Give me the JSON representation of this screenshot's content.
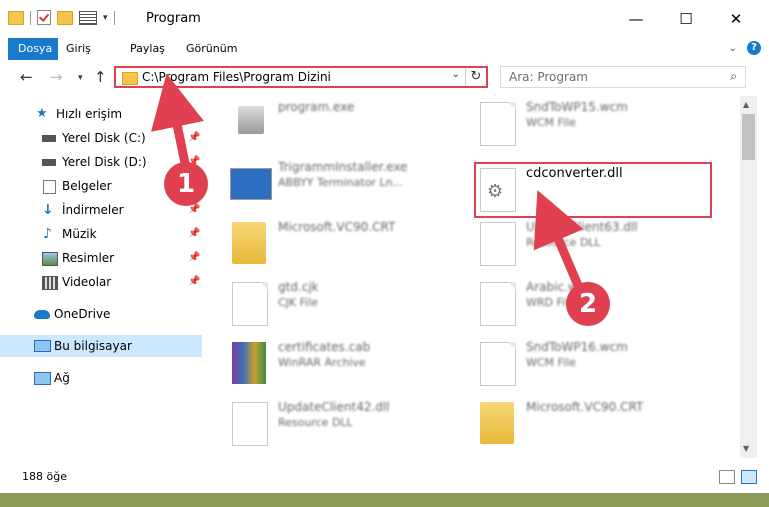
{
  "window": {
    "title": "Program"
  },
  "ribbon": {
    "tabs": [
      "Dosya",
      "Giriş",
      "Paylaş",
      "Görünüm"
    ]
  },
  "nav": {
    "address": "C:\\Program Files\\Program Dizini",
    "search_placeholder": "Ara: Program"
  },
  "sidebar": {
    "items": [
      {
        "label": "Hızlı erişim",
        "icon": "star-icon",
        "pinned": false
      },
      {
        "label": "Yerel Disk (C:)",
        "icon": "drive-icon",
        "pinned": true
      },
      {
        "label": "Yerel Disk (D:)",
        "icon": "drive-icon",
        "pinned": true
      },
      {
        "label": "Belgeler",
        "icon": "documents-icon",
        "pinned": true
      },
      {
        "label": "İndirmeler",
        "icon": "download-icon",
        "pinned": true
      },
      {
        "label": "Müzik",
        "icon": "music-icon",
        "pinned": true
      },
      {
        "label": "Resimler",
        "icon": "pictures-icon",
        "pinned": true
      },
      {
        "label": "Videolar",
        "icon": "videos-icon",
        "pinned": true
      },
      {
        "label": "OneDrive",
        "icon": "cloud-icon",
        "pinned": false
      },
      {
        "label": "Bu bilgisayar",
        "icon": "computer-icon",
        "pinned": false,
        "selected": true
      },
      {
        "label": "Ağ",
        "icon": "network-icon",
        "pinned": false
      }
    ]
  },
  "files": [
    {
      "name": "program.exe",
      "type": "",
      "icon": "exe-icon"
    },
    {
      "name": "SndToWP15.wcm",
      "type": "WCM File",
      "icon": "document-icon"
    },
    {
      "name": "TrigrammInstaller.exe",
      "type": "ABBYY Terminator Ln...",
      "icon": "installer-icon"
    },
    {
      "name": "cdconverter.dll",
      "type": "",
      "icon": "dll-gear-icon"
    },
    {
      "name": "Microsoft.VC90.CRT",
      "type": "",
      "icon": "folder-icon"
    },
    {
      "name": "UpdateClient63.dll",
      "type": "Resource DLL",
      "icon": "dll-gear-icon"
    },
    {
      "name": "gtd.cjk",
      "type": "CJK File",
      "icon": "document-icon"
    },
    {
      "name": "Arabic.wrd",
      "type": "WRD File",
      "icon": "document-icon"
    },
    {
      "name": "certificates.cab",
      "type": "WinRAR Archive",
      "icon": "archive-icon"
    },
    {
      "name": "SndToWP16.wcm",
      "type": "WCM File",
      "icon": "document-icon"
    },
    {
      "name": "UpdateClient42.dll",
      "type": "Resource DLL",
      "icon": "dll-gear-icon"
    },
    {
      "name": "Microsoft.VC90.CRT",
      "type": "",
      "icon": "folder-icon"
    }
  ],
  "status": {
    "count": "188 öğe"
  },
  "callouts": [
    "1",
    "2"
  ],
  "colors": {
    "accent": "#1979ca",
    "highlight": "#e04050"
  }
}
